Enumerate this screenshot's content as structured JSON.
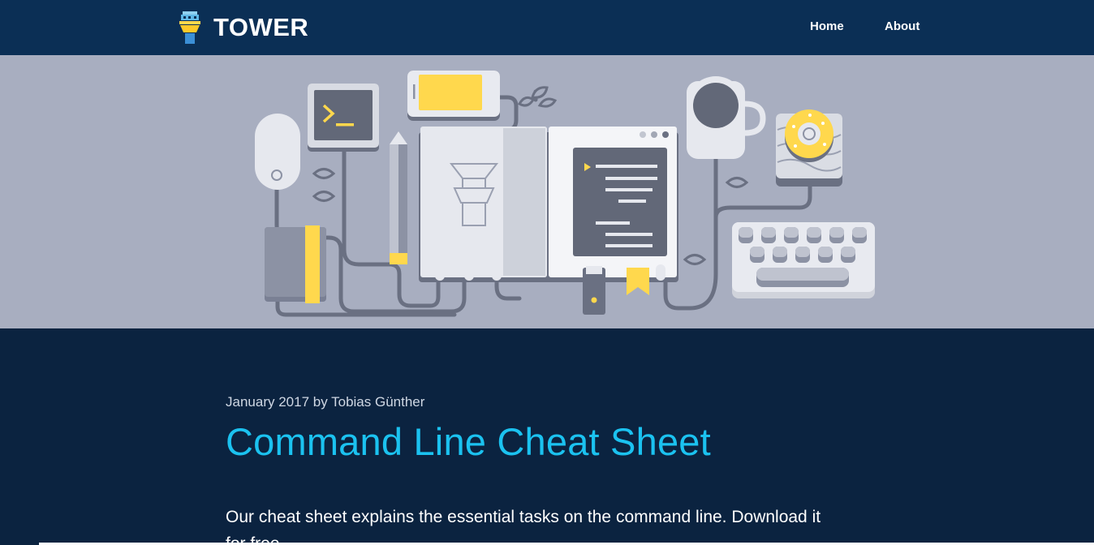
{
  "brand": {
    "name": "TOWER",
    "logo_icon": "tower-logo-icon"
  },
  "nav": {
    "home_label": "Home",
    "about_label": "About"
  },
  "hero": {
    "illustration": "command-line-workspace-illustration"
  },
  "article": {
    "meta": "January 2017 by Tobias Günther",
    "title": "Command Line Cheat Sheet",
    "intro": "Our cheat sheet explains the essential tasks on the command line. Download it for free."
  },
  "colors": {
    "nav_bg": "#0b2f55",
    "page_bg": "#0b2340",
    "hero_bg": "#a8aec0",
    "title": "#1bc2f0",
    "accent_yellow": "#ffd84d"
  }
}
